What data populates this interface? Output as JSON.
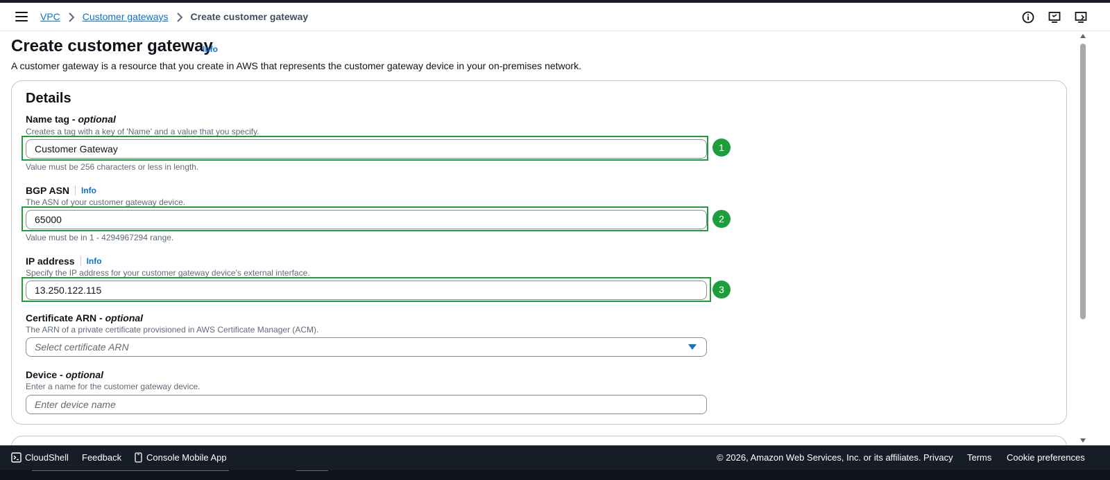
{
  "breadcrumb": {
    "items": [
      "VPC",
      "Customer gateways"
    ],
    "current": "Create customer gateway"
  },
  "page": {
    "title": "Create customer gateway",
    "title_info": "Info",
    "description": "A customer gateway is a resource that you create in AWS that represents the customer gateway device in your on-premises network."
  },
  "details": {
    "title": "Details",
    "name_tag": {
      "label": "Name tag - ",
      "label_optional": "optional",
      "description": "Creates a tag with a key of 'Name' and a value that you specify.",
      "value": "Customer Gateway",
      "constraint": "Value must be 256 characters or less in length.",
      "badge": "1"
    },
    "bgp_asn": {
      "label": "BGP ASN",
      "info": "Info",
      "description": "The ASN of your customer gateway device.",
      "value": "65000",
      "constraint": "Value must be in 1 - 4294967294 range.",
      "badge": "2"
    },
    "ip_address": {
      "label": "IP address",
      "info": "Info",
      "description": "Specify the IP address for your customer gateway device's external interface.",
      "value": "13.250.122.115",
      "badge": "3"
    },
    "certificate_arn": {
      "label": "Certificate ARN - ",
      "label_optional": "optional",
      "description": "The ARN of a private certificate provisioned in AWS Certificate Manager (ACM).",
      "placeholder": "Select certificate ARN"
    },
    "device": {
      "label": "Device - ",
      "label_optional": "optional",
      "description": "Enter a name for the customer gateway device.",
      "placeholder": "Enter device name"
    }
  },
  "footer": {
    "cloudshell": "CloudShell",
    "feedback": "Feedback",
    "mobile_app": "Console Mobile App",
    "copyright": "© 2026, Amazon Web Services, Inc. or its affiliates.",
    "privacy": "Privacy",
    "terms": "Terms",
    "cookie": "Cookie preferences"
  },
  "colors": {
    "link": "#0972d3",
    "highlight": "#1d9e3c",
    "footer_bg": "#161d26"
  }
}
